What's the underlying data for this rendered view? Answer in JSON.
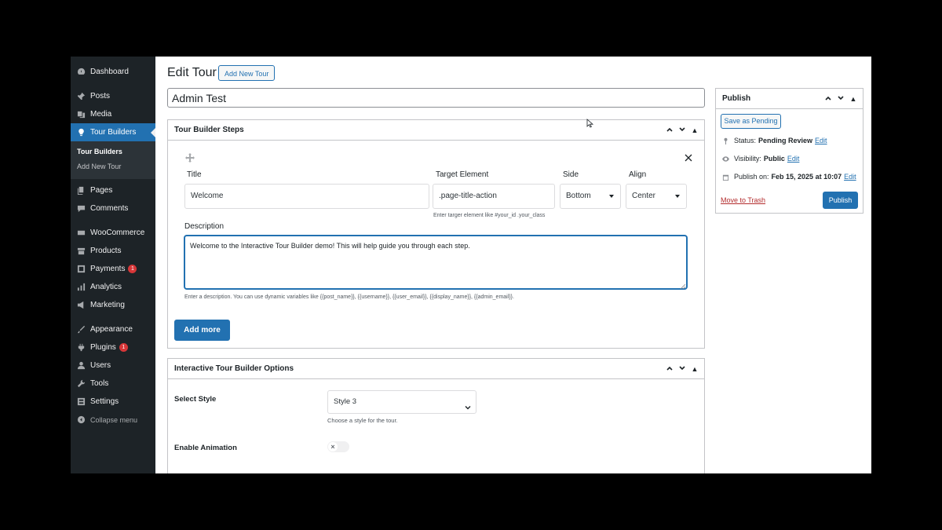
{
  "sidebar": {
    "items": [
      {
        "label": "Dashboard",
        "icon": "dashboard-icon"
      },
      {
        "label": "Posts",
        "icon": "pin-icon"
      },
      {
        "label": "Media",
        "icon": "media-icon"
      },
      {
        "label": "Tour Builders",
        "icon": "lightbulb-icon",
        "active": true
      },
      {
        "label": "Pages",
        "icon": "pages-icon"
      },
      {
        "label": "Comments",
        "icon": "comment-icon"
      },
      {
        "label": "WooCommerce",
        "icon": "woo-icon"
      },
      {
        "label": "Products",
        "icon": "products-icon"
      },
      {
        "label": "Payments",
        "icon": "payments-icon",
        "badge": "1"
      },
      {
        "label": "Analytics",
        "icon": "analytics-icon"
      },
      {
        "label": "Marketing",
        "icon": "megaphone-icon"
      },
      {
        "label": "Appearance",
        "icon": "brush-icon"
      },
      {
        "label": "Plugins",
        "icon": "plugin-icon",
        "badge": "1"
      },
      {
        "label": "Users",
        "icon": "user-icon"
      },
      {
        "label": "Tools",
        "icon": "wrench-icon"
      },
      {
        "label": "Settings",
        "icon": "settings-icon"
      }
    ],
    "submenu": [
      "Tour Builders",
      "Add New Tour"
    ],
    "collapse_label": "Collapse menu"
  },
  "header": {
    "title": "Edit Tour",
    "add_new_label": "Add New Tour"
  },
  "post_title": "Admin Test",
  "steps_box": {
    "title": "Tour Builder Steps",
    "labels": {
      "title": "Title",
      "target": "Target Element",
      "side": "Side",
      "align": "Align",
      "description": "Description"
    },
    "values": {
      "title": "Welcome",
      "target": ".page-title-action",
      "side": "Bottom",
      "align": "Center",
      "description": "Welcome to the Interactive Tour Builder demo! This will help guide you through each step."
    },
    "target_hint": "Enter targer element like #your_id .your_class",
    "description_hint": "Enter a description. You can use dynamic variables like {{post_name}}, {{username}}, {{user_email}}, {{display_name}}, {{admin_email}}.",
    "add_more_label": "Add more"
  },
  "options_box": {
    "title": "Interactive Tour Builder Options",
    "select_style_label": "Select Style",
    "select_style_value": "Style 3",
    "select_style_hint": "Choose a style for the tour.",
    "enable_animation_label": "Enable Animation"
  },
  "publish": {
    "title": "Publish",
    "save_pending_label": "Save as Pending",
    "status_label": "Status:",
    "status_value": "Pending Review",
    "visibility_label": "Visibility:",
    "visibility_value": "Public",
    "publish_on_label": "Publish on:",
    "publish_on_value": "Feb 15, 2025 at 10:07",
    "edit_label": "Edit",
    "trash_label": "Move to Trash",
    "publish_label": "Publish"
  },
  "colors": {
    "admin_sidebar": "#1d2327",
    "accent": "#2271b1",
    "badge": "#d63638"
  }
}
